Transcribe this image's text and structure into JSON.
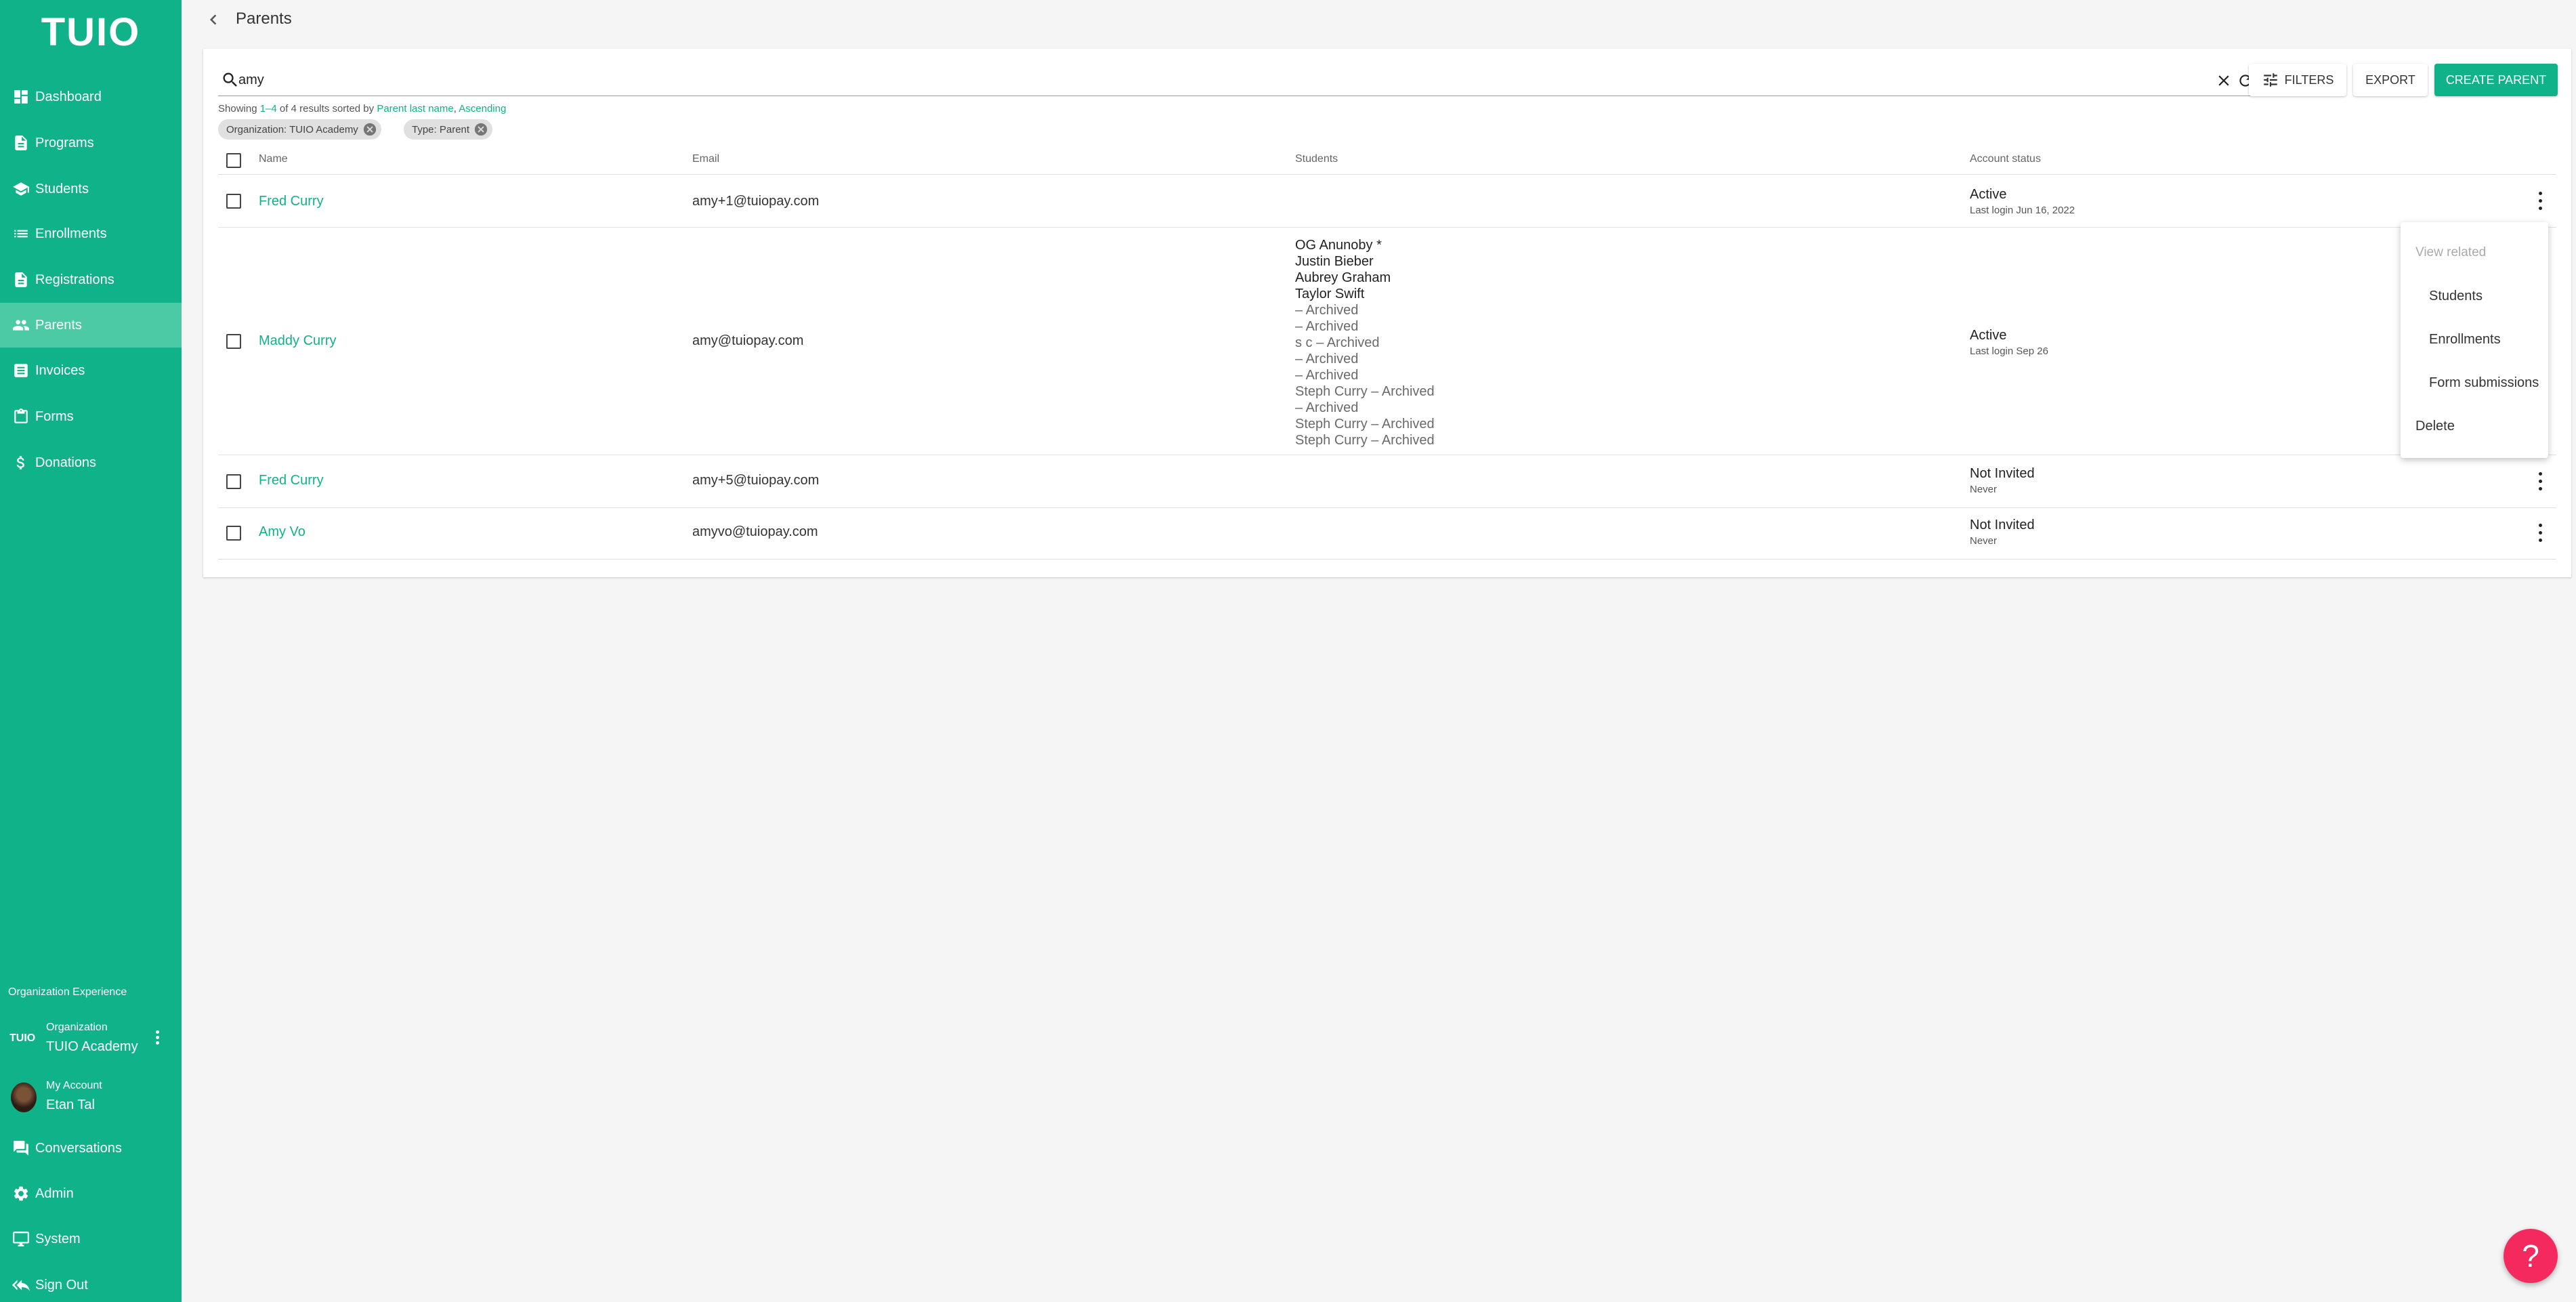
{
  "sidebar": {
    "logo": "TUIO",
    "items": [
      {
        "label": "Dashboard",
        "icon": "dashboard-icon"
      },
      {
        "label": "Programs",
        "icon": "programs-icon"
      },
      {
        "label": "Students",
        "icon": "students-icon"
      },
      {
        "label": "Enrollments",
        "icon": "enrollments-icon"
      },
      {
        "label": "Registrations",
        "icon": "registrations-icon"
      },
      {
        "label": "Parents",
        "icon": "parents-icon",
        "active": true
      },
      {
        "label": "Invoices",
        "icon": "invoices-icon"
      },
      {
        "label": "Forms",
        "icon": "forms-icon"
      },
      {
        "label": "Donations",
        "icon": "dollar-icon"
      }
    ],
    "org_experience_label": "Organization Experience",
    "org": {
      "logo": "TUIO",
      "small_label": "Organization",
      "name": "TUIO Academy"
    },
    "account": {
      "small_label": "My Account",
      "name": "Etan Tal"
    },
    "bottom_items": [
      {
        "label": "Conversations",
        "icon": "conversations-icon"
      },
      {
        "label": "Admin",
        "icon": "gear-icon"
      },
      {
        "label": "System",
        "icon": "monitor-icon"
      },
      {
        "label": "Sign Out",
        "icon": "sign-out-icon"
      }
    ]
  },
  "header": {
    "title": "Parents"
  },
  "search": {
    "value": "amy"
  },
  "toolbar": {
    "filters_label": "FILTERS",
    "export_label": "EXPORT",
    "create_label": "CREATE PARENT"
  },
  "results": {
    "prefix": "Showing ",
    "range": "1–4",
    "of_text": " of 4 results sorted by ",
    "sort_field": "Parent last name",
    "comma": ", ",
    "sort_dir": "Ascending"
  },
  "chips": [
    {
      "label": "Organization: TUIO Academy"
    },
    {
      "label": "Type: Parent"
    }
  ],
  "table": {
    "headers": {
      "name": "Name",
      "email": "Email",
      "students": "Students",
      "status": "Account status"
    },
    "rows": [
      {
        "name": "Fred Curry",
        "email": "amy+1@tuiopay.com",
        "status": "Active",
        "status_sub": "Last login Jun 16, 2022",
        "students": []
      },
      {
        "name": "Maddy Curry",
        "email": "amy@tuiopay.com",
        "status": "Active",
        "status_sub": "Last login Sep 26",
        "students": [
          {
            "text": "OG Anunoby *",
            "archived": false
          },
          {
            "text": "Justin Bieber",
            "archived": false
          },
          {
            "text": "Aubrey Graham",
            "archived": false
          },
          {
            "text": "Taylor Swift",
            "archived": false
          },
          {
            "text": "– Archived",
            "archived": true
          },
          {
            "text": "– Archived",
            "archived": true
          },
          {
            "text": "s c – Archived",
            "archived": true
          },
          {
            "text": "– Archived",
            "archived": true
          },
          {
            "text": "– Archived",
            "archived": true
          },
          {
            "text": "Steph Curry – Archived",
            "archived": true
          },
          {
            "text": "– Archived",
            "archived": true
          },
          {
            "text": "Steph Curry – Archived",
            "archived": true
          },
          {
            "text": "Steph Curry – Archived",
            "archived": true
          }
        ]
      },
      {
        "name": "Fred Curry",
        "email": "amy+5@tuiopay.com",
        "status": "Not Invited",
        "status_sub": "Never",
        "students": []
      },
      {
        "name": "Amy Vo",
        "email": "amyvo@tuiopay.com",
        "status": "Not Invited",
        "status_sub": "Never",
        "students": []
      }
    ]
  },
  "menu": {
    "header": "View related",
    "items": [
      "Students",
      "Enrollments",
      "Form submissions"
    ],
    "delete_label": "Delete"
  },
  "help": {
    "label": "?"
  },
  "colors": {
    "brand": "#10b28a",
    "active_nav": "#4ccaa6",
    "help": "#f42a5e"
  }
}
